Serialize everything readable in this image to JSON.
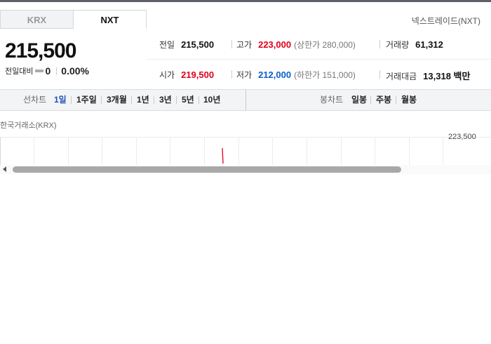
{
  "tabs": [
    {
      "label": "KRX",
      "active": false
    },
    {
      "label": "NXT",
      "active": true
    }
  ],
  "market_label": "넥스트레이드(NXT)",
  "price": {
    "current": "215,500",
    "change_label": "전일대비",
    "change_value": "0",
    "change_percent": "0.00%"
  },
  "info": {
    "prev_close": {
      "label": "전일",
      "value": "215,500"
    },
    "high": {
      "label": "고가",
      "value": "223,000",
      "sub": "(상한가 280,000)"
    },
    "volume": {
      "label": "거래량",
      "value": "61,312"
    },
    "open": {
      "label": "시가",
      "value": "219,500"
    },
    "low": {
      "label": "저가",
      "value": "212,000",
      "sub": "(하한가 151,000)"
    },
    "turnover": {
      "label": "거래대금",
      "value": "13,318 백만"
    }
  },
  "toolbar": {
    "line_chart_label": "선차트",
    "line_periods": [
      "1일",
      "1주일",
      "3개월",
      "1년",
      "3년",
      "5년",
      "10년"
    ],
    "active_period": "1일",
    "candle_chart_label": "봉차트",
    "candle_periods": [
      "일봉",
      "주봉",
      "월봉"
    ]
  },
  "chart": {
    "exchange_label": "한국거래소(KRX)",
    "y_tick_label": "223,500",
    "colors": {
      "price_line": "#e0001a",
      "grid": "#ececec"
    }
  }
}
